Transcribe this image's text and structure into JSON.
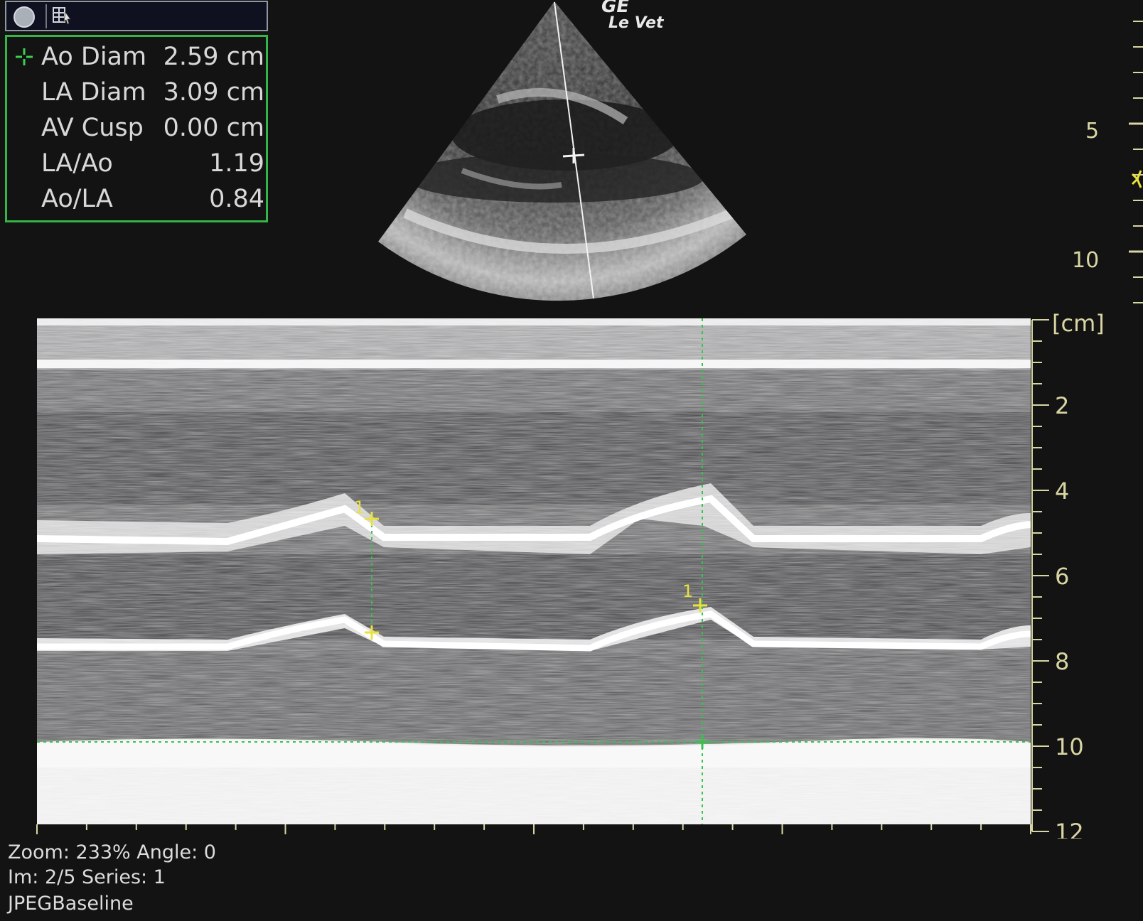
{
  "toolbar": {
    "record_icon": "circle-button-icon",
    "grid_icon": "grid-cursor-icon"
  },
  "measurements": [
    {
      "label": "Ao Diam",
      "value": "2.59 cm",
      "active": true
    },
    {
      "label": "LA Diam",
      "value": "3.09 cm",
      "active": false
    },
    {
      "label": "AV Cusp",
      "value": "0.00 cm",
      "active": false
    },
    {
      "label": "LA/Ao",
      "value": "1.19",
      "active": false
    },
    {
      "label": "Ao/LA",
      "value": "0.84",
      "active": false
    }
  ],
  "logo": {
    "line1": "GE",
    "line2": "Le Vet"
  },
  "sector_depth_scale": {
    "ticks": [
      "5",
      "10"
    ],
    "range_cm": [
      0,
      13
    ]
  },
  "mmode": {
    "depth_unit": "[cm]",
    "depth_ticks": [
      "2",
      "4",
      "6",
      "8",
      "10",
      "12"
    ],
    "depth_range_cm": [
      0,
      12
    ],
    "time_ticks": [
      "-2.0",
      "-1.5",
      "-1.0",
      "-0.5",
      "0.0"
    ],
    "time_range_s": [
      -2.0,
      0.0
    ],
    "caliper_marker": "1"
  },
  "info": {
    "zoom_line": "Zoom: 233% Angle: 0",
    "image_line": "Im: 2/5  Series:  1",
    "format_line": "JPEGBaseline"
  },
  "colors": {
    "panel_border": "#34b548",
    "scale_text": "#d9d6a3",
    "caliper": "#e8e23a",
    "crosshair": "#35c34b"
  }
}
